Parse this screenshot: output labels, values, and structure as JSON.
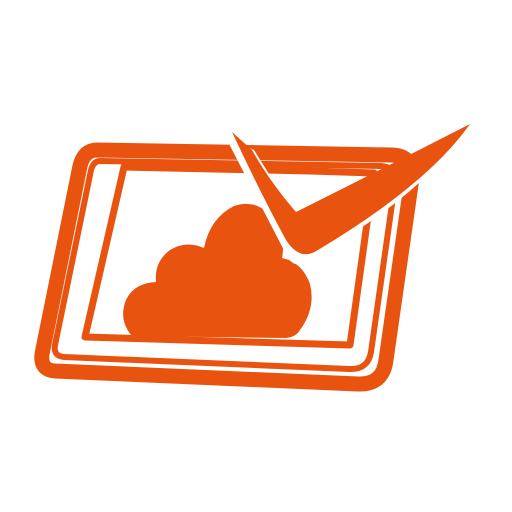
{
  "icon": {
    "name": "tablet-cloud-checkmark-icon",
    "brand_color": "#E8540F",
    "background_color": "#FFFFFF",
    "parts": [
      "tablet-outer-frame-icon",
      "tablet-screen-icon",
      "cloud-icon",
      "checkmark-icon"
    ]
  }
}
